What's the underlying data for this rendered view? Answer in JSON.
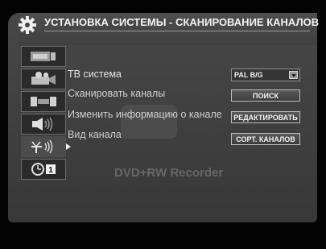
{
  "header": {
    "title": "УСТАНОВКА СИСТЕМЫ - СКАНИРОВАНИЕ КАНАЛОВ",
    "icon": "gear-icon"
  },
  "sidebar": {
    "items": [
      {
        "icon": "video-card-icon",
        "active": false
      },
      {
        "icon": "film-projector-icon",
        "active": false
      },
      {
        "icon": "recorder-deck-icon",
        "active": false
      },
      {
        "icon": "speaker-audio-icon",
        "active": false
      },
      {
        "icon": "antenna-signal-icon",
        "active": true
      },
      {
        "icon": "clock-timer-icon",
        "active": false,
        "badge": "1"
      }
    ]
  },
  "menu": {
    "items": [
      {
        "label": "ТВ система"
      },
      {
        "label": "Сканировать каналы"
      },
      {
        "label": "Изменить информацию о канале"
      },
      {
        "label": "Вид канала"
      }
    ]
  },
  "controls": {
    "tv_system_value": "PAL B/G",
    "search_label": "ПОИСК",
    "edit_label": "РЕДАКТИРОВАТЬ",
    "sort_label": "СОРТ. КАНАЛОВ"
  },
  "watermark": {
    "text": "DVD+RW Recorder"
  },
  "colors": {
    "background": "#030303",
    "panel": "#444444",
    "text": "#e4e4e4",
    "button_border": "#bdbdbd"
  }
}
